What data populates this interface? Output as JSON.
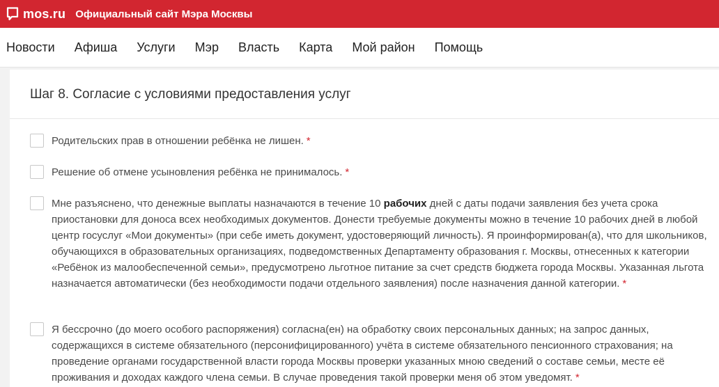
{
  "header": {
    "logo_text": "mos.ru",
    "site_title": "Официальный сайт Мэра Москвы"
  },
  "nav": {
    "items": [
      "Новости",
      "Афиша",
      "Услуги",
      "Мэр",
      "Власть",
      "Карта",
      "Мой район",
      "Помощь"
    ]
  },
  "form": {
    "step_title": "Шаг 8. Согласие с условиями предоставления услуг",
    "asterisk": "*",
    "items": [
      {
        "text": "Родительских прав в отношении ребёнка не лишен."
      },
      {
        "text": "Решение об отмене усыновления ребёнка не принималось."
      },
      {
        "text_before": "Мне разъяснено, что денежные выплаты назначаются в течение 10 ",
        "text_bold": "рабочих",
        "text_after": " дней с даты подачи заявления без учета срока приостановки для доноса всех необходимых документов. Донести требуемые документы можно в течение 10 рабочих дней в любой центр госуслуг «Мои документы» (при себе иметь документ, удостоверяющий личность). Я проинформирован(а), что для школьников, обучающихся в образовательных организациях, подведомственных Департаменту образования г. Москвы, отнесенных к категории «Ребёнок из малообеспеченной семьи», предусмотрено льготное питание за счет средств бюджета города Москвы. Указанная льгота назначается автоматически (без необходимости подачи отдельного заявления) после назначения данной категории."
      },
      {
        "text": "Я бессрочно (до моего особого распоряжения) согласна(ен) на обработку своих персональных данных; на запрос данных, содержащихся в системе обязательного (персонифицированного) учёта в системе обязательного пенсионного страхования; на проведение органами государственной власти города Москвы проверки указанных мною сведений о составе семьи, месте её проживания и доходах каждого члена семьи. В случае проведения такой проверки меня об этом уведомят."
      }
    ]
  },
  "colors": {
    "brand_red": "#d22630"
  }
}
